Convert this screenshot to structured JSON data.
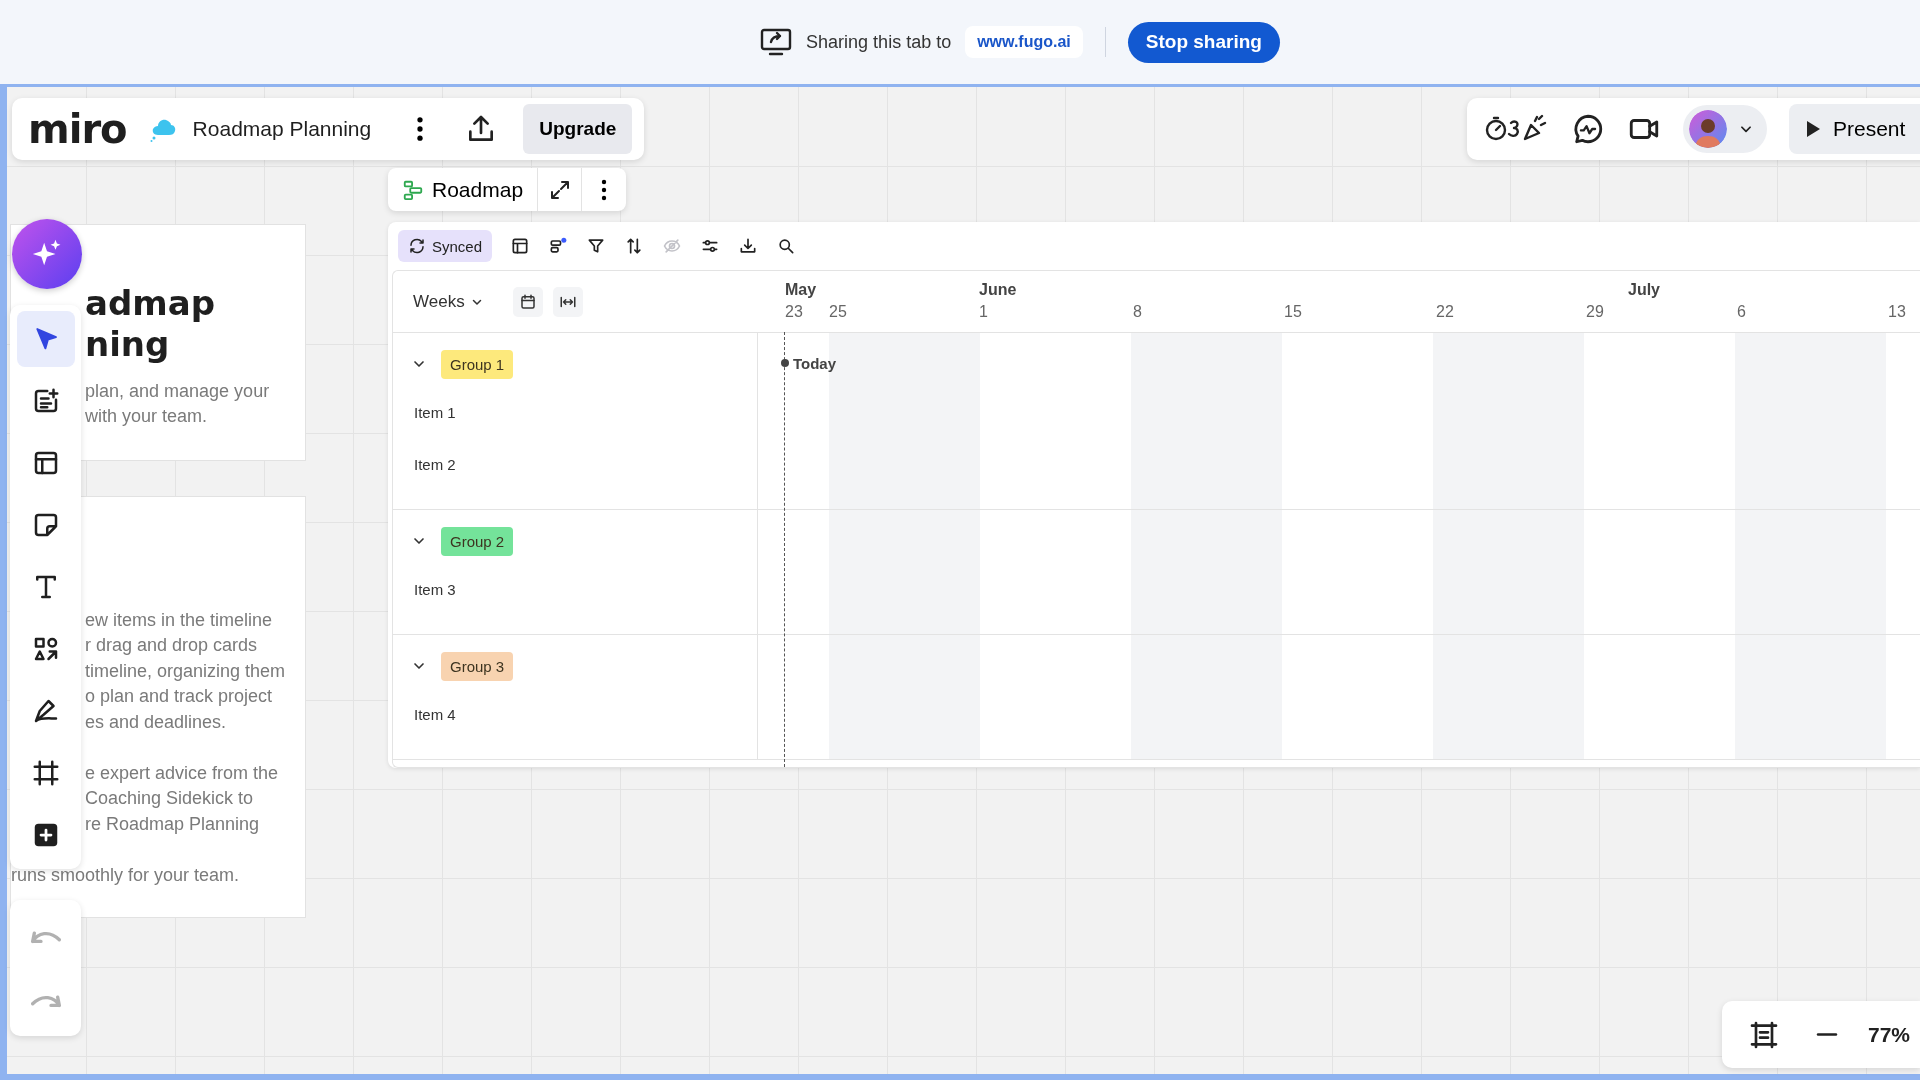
{
  "share_bar": {
    "text": "Sharing this tab to",
    "link": "www.fugo.ai",
    "button": "Stop sharing"
  },
  "board_bar": {
    "logo": "miro",
    "title": "Roadmap Planning",
    "upgrade": "Upgrade"
  },
  "widget_tab": {
    "title": "Roadmap"
  },
  "doc_cards": [
    {
      "heading": [
        "admap",
        "ning"
      ],
      "paragraphs": [
        [
          "plan, and manage your",
          "with your team."
        ]
      ]
    },
    {
      "paragraphs": [
        [
          "ew items in the timeline",
          "r drag and drop cards",
          "timeline, organizing them",
          "o plan and track project",
          "es and deadlines."
        ],
        [
          "e expert advice from the",
          "Coaching Sidekick to",
          "re Roadmap Planning"
        ]
      ],
      "footer": "runs smoothly for your team."
    }
  ],
  "tools": [
    {
      "kind": "select",
      "selected": true
    },
    {
      "kind": "templates",
      "selected": false
    },
    {
      "kind": "table",
      "selected": false
    },
    {
      "kind": "sticky",
      "selected": false
    },
    {
      "kind": "text",
      "selected": false
    },
    {
      "kind": "shapes",
      "selected": false
    },
    {
      "kind": "pen",
      "selected": false
    },
    {
      "kind": "frame",
      "selected": false
    },
    {
      "kind": "more",
      "selected": false
    }
  ],
  "history": [
    {
      "kind": "undo",
      "disabled": true
    },
    {
      "kind": "redo",
      "disabled": true
    }
  ],
  "collab_bar": {
    "present": "Present"
  },
  "roadmap": {
    "sync": "Synced",
    "toolbar": [
      {
        "kind": "layout",
        "disabled": false
      },
      {
        "kind": "grouping",
        "disabled": false
      },
      {
        "kind": "filter",
        "disabled": false
      },
      {
        "kind": "sort",
        "disabled": false
      },
      {
        "kind": "hide",
        "disabled": true
      },
      {
        "kind": "settings",
        "disabled": false
      },
      {
        "kind": "export",
        "disabled": false
      },
      {
        "kind": "search",
        "disabled": false
      }
    ],
    "scale": "Weeks",
    "months": [
      "May",
      "June",
      "July"
    ],
    "dates": [
      "23",
      "25",
      "1",
      "8",
      "15",
      "22",
      "29",
      "6",
      "13"
    ],
    "today": "Today",
    "groups": [
      {
        "label": "Group 1",
        "color": "#fde97c",
        "expanded": true,
        "items": [
          "Item 1",
          "Item 2"
        ]
      },
      {
        "label": "Group 2",
        "color": "#74e39a",
        "expanded": true,
        "items": [
          "Item 3"
        ]
      },
      {
        "label": "Group 3",
        "color": "#f8d3b0",
        "expanded": true,
        "items": [
          "Item 4"
        ]
      }
    ]
  },
  "zoom_bar": {
    "level": "77%"
  }
}
